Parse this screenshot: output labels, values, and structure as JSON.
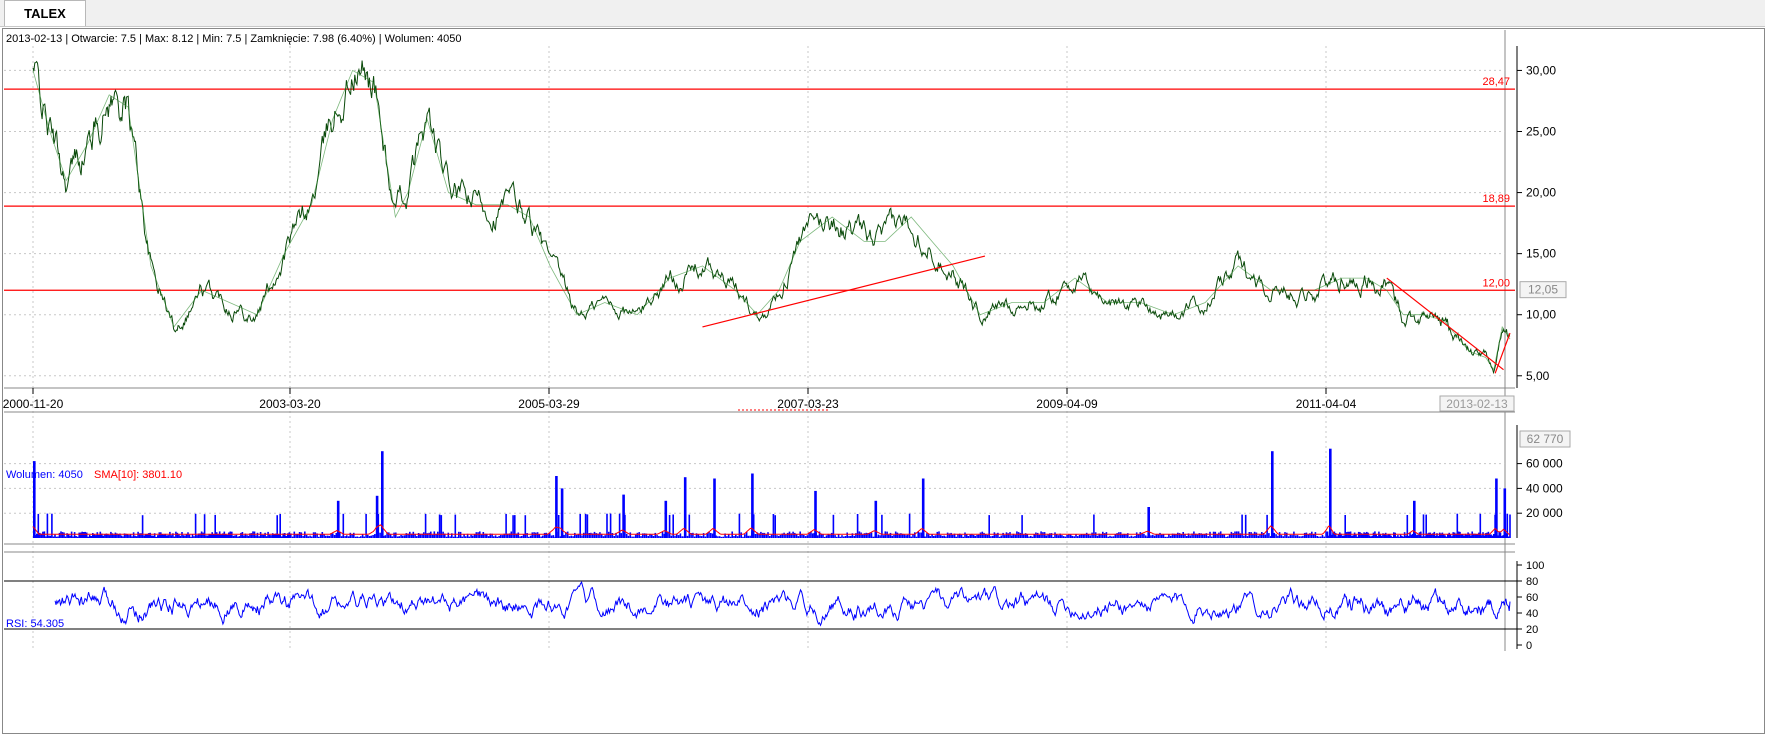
{
  "tab": {
    "label": "TALEX"
  },
  "header": {
    "info": "2013-02-13 | Otwarcie: 7.5 | Max: 8.12 | Min: 7.5 | Zamknięcie: 7.98 (6.40%)  | Wolumen: 4050"
  },
  "volume_panel": {
    "label_wolumen": "Wolumen: 4050",
    "label_sma": "SMA[10]: 3801.10"
  },
  "rsi_panel": {
    "label": "RSI: 54.305"
  },
  "colors": {
    "price": "#0a4a0a",
    "hline": "#ff0000",
    "volume": "#0000ff",
    "sma": "#ff0000",
    "rsi": "#0000ff",
    "grid": "#c8c8c8"
  },
  "chart_data": [
    {
      "type": "line",
      "name": "price",
      "x_labels": [
        "2000-11-20",
        "2003-03-20",
        "2005-03-29",
        "2007-03-23",
        "2009-04-09",
        "2011-04-04"
      ],
      "y_ticks": [
        "5,00",
        "10,00",
        "15,00",
        "20,00",
        "25,00",
        "30,00"
      ],
      "ylim": [
        4,
        32
      ],
      "xlim": [
        "2000-11-20",
        "2013-02-13"
      ],
      "current_value_label": "12,05",
      "current_date_label": "2013-02-13",
      "series": [
        {
          "x": [
            "2000-11-20",
            "2001-01-15",
            "2001-03-10",
            "2001-05-20",
            "2001-07-30",
            "2001-10-01",
            "2001-12-15",
            "2002-03-01",
            "2002-06-01",
            "2002-09-01",
            "2002-12-01",
            "2003-03-01",
            "2003-05-20",
            "2003-07-20",
            "2003-09-15",
            "2003-11-15",
            "2004-01-15",
            "2004-02-20",
            "2004-04-15",
            "2004-06-15",
            "2004-09-01",
            "2004-12-01",
            "2005-02-01",
            "2005-04-01",
            "2005-06-15",
            "2005-09-01",
            "2005-12-01",
            "2006-03-01",
            "2006-06-01",
            "2006-09-01",
            "2006-11-01",
            "2007-01-01",
            "2007-03-01",
            "2007-06-01",
            "2007-09-01",
            "2007-11-01",
            "2008-01-15",
            "2008-03-15",
            "2008-05-15",
            "2008-08-01",
            "2008-11-01",
            "2009-02-01",
            "2009-05-01",
            "2009-08-01",
            "2009-11-01",
            "2010-02-01",
            "2010-05-01",
            "2010-08-01",
            "2010-11-01",
            "2011-03-01",
            "2011-06-01",
            "2011-09-01",
            "2011-11-15",
            "2012-01-15",
            "2012-04-01",
            "2012-06-15",
            "2012-09-15",
            "2012-11-15",
            "2012-12-15",
            "2013-01-15",
            "2013-02-13"
          ],
          "y": [
            30,
            25,
            21,
            24,
            28,
            27,
            14,
            9,
            12,
            11,
            10,
            15,
            19,
            26,
            30,
            29,
            18,
            20,
            26,
            20,
            19,
            19,
            18,
            14,
            10,
            11,
            10,
            13,
            14,
            12,
            10,
            12,
            16,
            18,
            16,
            16,
            18,
            16,
            14,
            10,
            11,
            11,
            13,
            11,
            11,
            10,
            11,
            14,
            12,
            12,
            13,
            13,
            12,
            10,
            10,
            9.5,
            7,
            6.5,
            5.5,
            9,
            8
          ]
        }
      ],
      "horizontal_lines": [
        {
          "value": 28.47,
          "label": "28,47"
        },
        {
          "value": 18.89,
          "label": "18,89"
        },
        {
          "value": 12.0,
          "label": "12,00"
        }
      ],
      "trendlines": [
        {
          "from": {
            "x": "2006-06-01",
            "y": 9.0
          },
          "to": {
            "x": "2008-08-15",
            "y": 14.8
          }
        },
        {
          "from": {
            "x": "2011-11-15",
            "y": 13.0
          },
          "to": {
            "x": "2013-01-20",
            "y": 5.5
          }
        },
        {
          "from": {
            "x": "2012-12-20",
            "y": 5.2
          },
          "to": {
            "x": "2013-02-13",
            "y": 8.5
          }
        }
      ]
    },
    {
      "type": "bar",
      "name": "volume",
      "y_ticks": [
        "20 000",
        "40 000",
        "60 000"
      ],
      "ylim": [
        0,
        75000
      ],
      "current_value_label": "62 770",
      "series": [
        {
          "name": "Wolumen",
          "baseline": 3000,
          "spikes": [
            {
              "x": "2000-11-20",
              "y": 62000
            },
            {
              "x": "2003-08-01",
              "y": 30000
            },
            {
              "x": "2003-11-20",
              "y": 34000
            },
            {
              "x": "2003-12-05",
              "y": 70000
            },
            {
              "x": "2005-04-15",
              "y": 50000
            },
            {
              "x": "2005-05-01",
              "y": 40000
            },
            {
              "x": "2005-10-20",
              "y": 35000
            },
            {
              "x": "2006-02-15",
              "y": 30000
            },
            {
              "x": "2006-04-10",
              "y": 49000
            },
            {
              "x": "2006-07-01",
              "y": 48000
            },
            {
              "x": "2006-10-15",
              "y": 52000
            },
            {
              "x": "2007-04-10",
              "y": 38000
            },
            {
              "x": "2007-10-01",
              "y": 30000
            },
            {
              "x": "2008-02-15",
              "y": 48000
            },
            {
              "x": "2009-11-20",
              "y": 25000
            },
            {
              "x": "2010-11-01",
              "y": 70000
            },
            {
              "x": "2011-04-15",
              "y": 72000
            },
            {
              "x": "2012-02-20",
              "y": 30000
            },
            {
              "x": "2012-12-20",
              "y": 48000
            },
            {
              "x": "2013-01-20",
              "y": 40000
            }
          ]
        },
        {
          "name": "SMA[10]",
          "value": 3801.1
        }
      ]
    },
    {
      "type": "line",
      "name": "RSI",
      "y_ticks": [
        "0",
        "20",
        "40",
        "60",
        "80",
        "100"
      ],
      "ylim": [
        0,
        100
      ],
      "levels": [
        20,
        80
      ],
      "series": [
        {
          "name": "RSI",
          "x_start": "2001-02-01",
          "x_end": "2013-02-13",
          "last": 54.305,
          "range": [
            10,
            90
          ]
        }
      ]
    }
  ]
}
